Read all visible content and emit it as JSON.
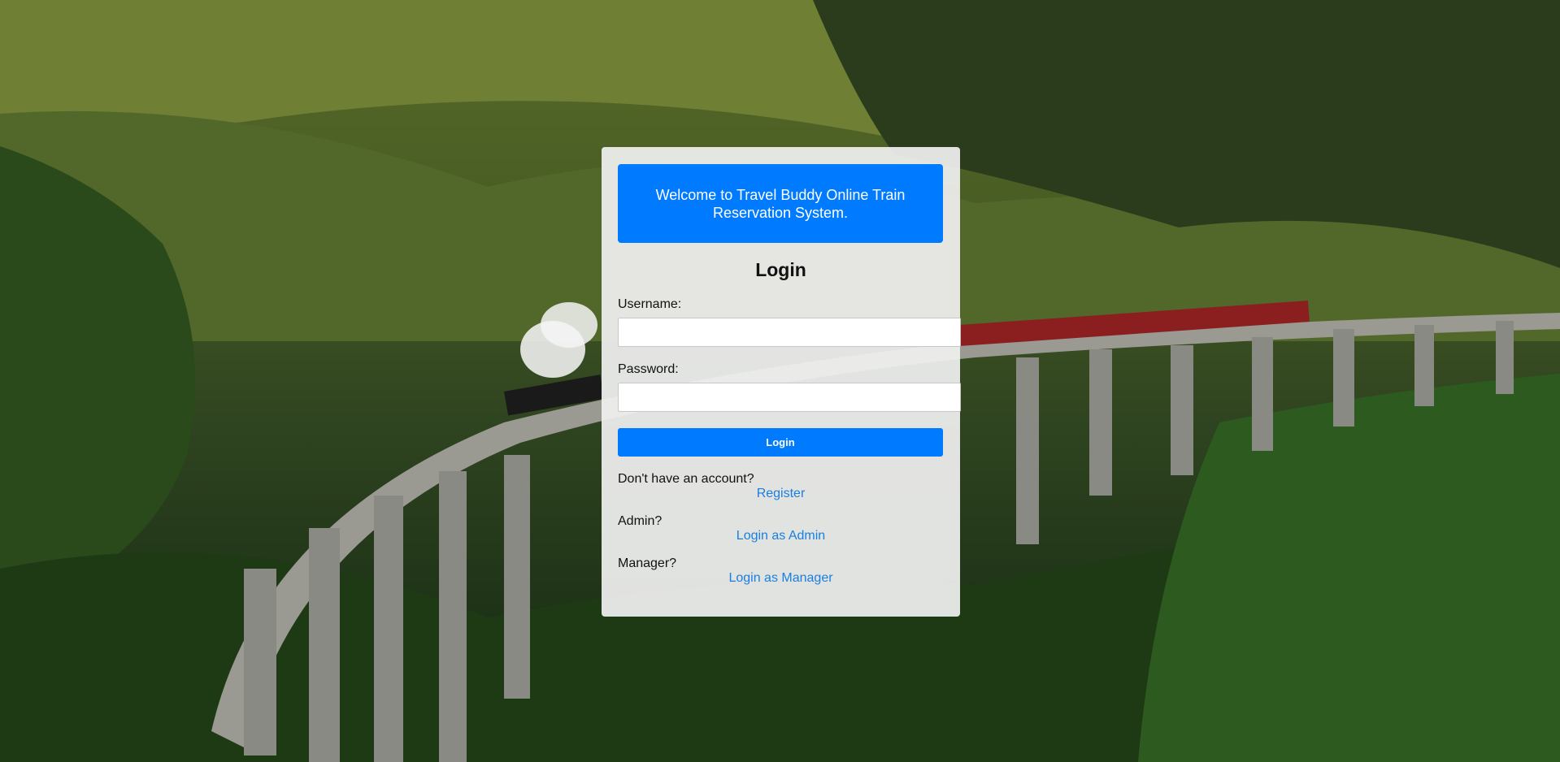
{
  "banner": {
    "text": "Welcome to Travel Buddy Online Train Reservation System."
  },
  "login": {
    "title": "Login",
    "username_label": "Username:",
    "username_value": "",
    "password_label": "Password:",
    "password_value": "",
    "submit_label": "Login"
  },
  "links": {
    "register_prompt": "Don't have an account?",
    "register_label": "Register",
    "admin_prompt": "Admin?",
    "admin_label": "Login as Admin",
    "manager_prompt": "Manager?",
    "manager_label": "Login as Manager"
  },
  "colors": {
    "accent": "#007bff",
    "link": "#1a7fe0"
  }
}
